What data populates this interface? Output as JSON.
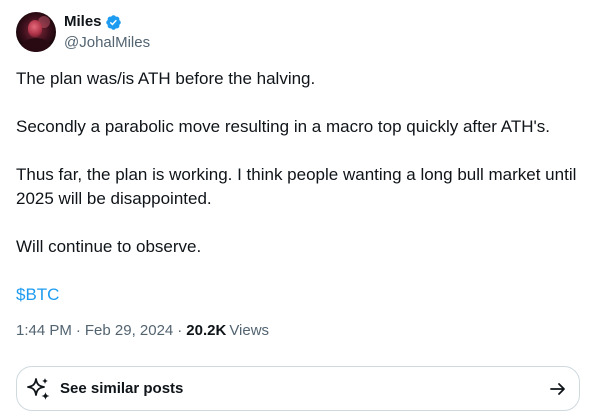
{
  "author": {
    "display_name": "Miles",
    "handle": "@JohalMiles",
    "verified": true,
    "avatar_icon": "profile-photo"
  },
  "post": {
    "paragraphs": [
      "The plan was/is ATH before the halving.",
      "Secondly a parabolic move resulting in a macro top quickly after ATH's.",
      "Thus far, the plan is working. I think people wanting a long bull market until 2025 will be disappointed.",
      "Will continue to observe."
    ],
    "cashtag": "$BTC"
  },
  "meta": {
    "time": "1:44 PM",
    "separator": "·",
    "date": "Feb 29, 2024",
    "views_count": "20.2K",
    "views_label": "Views"
  },
  "similar_posts": {
    "label": "See similar posts",
    "icon": "sparkle-icon",
    "arrow_icon": "arrow-right-icon"
  },
  "colors": {
    "text_primary": "#0f1419",
    "text_secondary": "#536471",
    "accent": "#1d9bf0",
    "border": "#cfd9de"
  }
}
